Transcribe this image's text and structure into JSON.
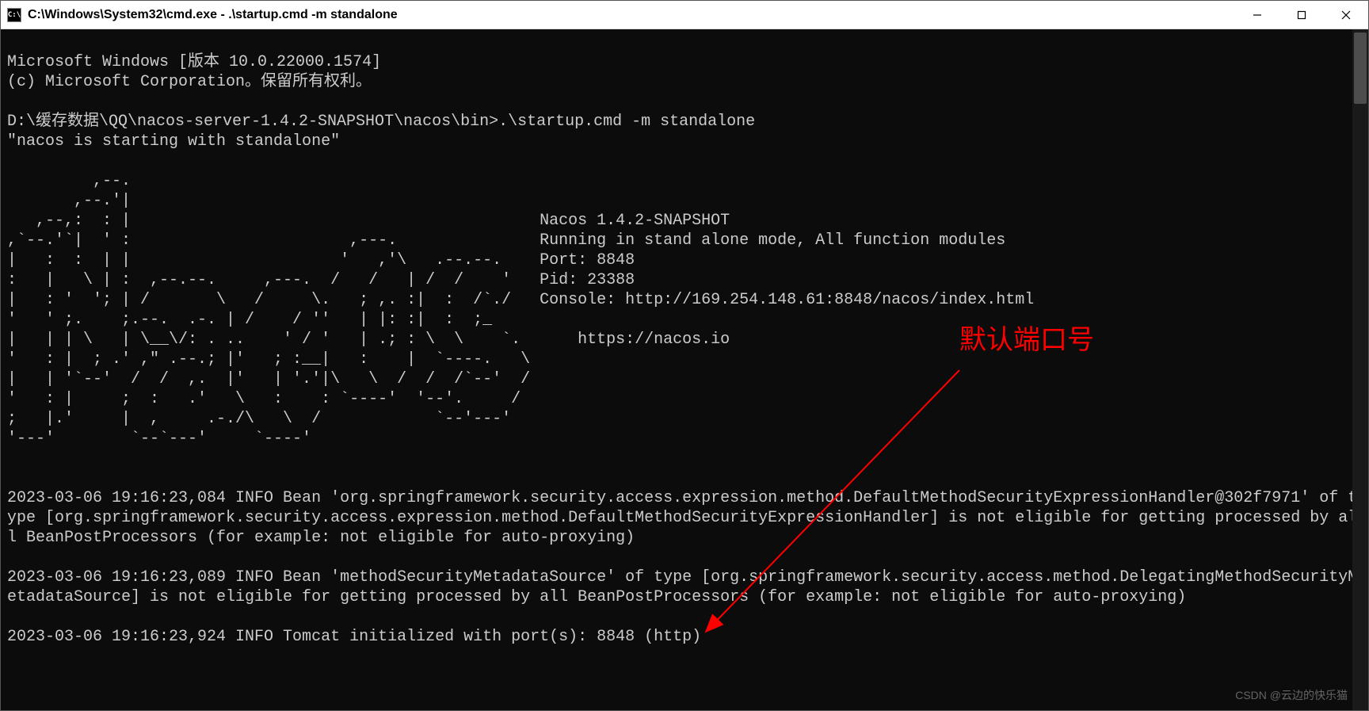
{
  "window": {
    "title": "C:\\Windows\\System32\\cmd.exe - .\\startup.cmd  -m standalone"
  },
  "terminal": {
    "header1": "Microsoft Windows [版本 10.0.22000.1574]",
    "header2": "(c) Microsoft Corporation。保留所有权利。",
    "prompt_line": "D:\\缓存数据\\QQ\\nacos-server-1.4.2-SNAPSHOT\\nacos\\bin>.\\startup.cmd -m standalone",
    "starting_line": "\"nacos is starting with standalone\"",
    "ascii_art": "         ,--.\n       ,--.'|\n   ,--,:  : |                                           Nacos 1.4.2-SNAPSHOT\n,`--.'`|  ' :                       ,---.               Running in stand alone mode, All function modules\n|   :  :  | |                      '   ,'\\   .--.--.    Port: 8848\n:   |   \\ | :  ,--.--.     ,---.  /   /   | /  /    '   Pid: 23388\n|   : '  '; | /       \\   /     \\.   ; ,. :|  :  /`./   Console: http://169.254.148.61:8848/nacos/index.html\n'   ' ;.    ;.--.  .-. | /    / ''   | |: :|  :  ;_\n|   | | \\   | \\__\\/: . ..    ' / '   | .; : \\  \\    `.      https://nacos.io\n'   : |  ; .' ,\" .--.; |'   ; :__|   :    |  `----.   \\\n|   | '`--'  /  /  ,.  |'   | '.'|\\   \\  /  /  /`--'  /\n'   : |     ;  :   .'   \\   :    : `----'  '--'.     /\n;   |.'     |  ,     .-./\\   \\  /            `--'---'\n'---'        `--`---'     `----'",
    "log1": "2023-03-06 19:16:23,084 INFO Bean 'org.springframework.security.access.expression.method.DefaultMethodSecurityExpressionHandler@302f7971' of type [org.springframework.security.access.expression.method.DefaultMethodSecurityExpressionHandler] is not eligible for getting processed by all BeanPostProcessors (for example: not eligible for auto-proxying)",
    "log2": "2023-03-06 19:16:23,089 INFO Bean 'methodSecurityMetadataSource' of type [org.springframework.security.access.method.DelegatingMethodSecurityMetadataSource] is not eligible for getting processed by all BeanPostProcessors (for example: not eligible for auto-proxying)",
    "log3": "2023-03-06 19:16:23,924 INFO Tomcat initialized with port(s): 8848 (http)"
  },
  "annotation": {
    "label": "默认端口号"
  },
  "watermark": "CSDN @云边的快乐猫"
}
